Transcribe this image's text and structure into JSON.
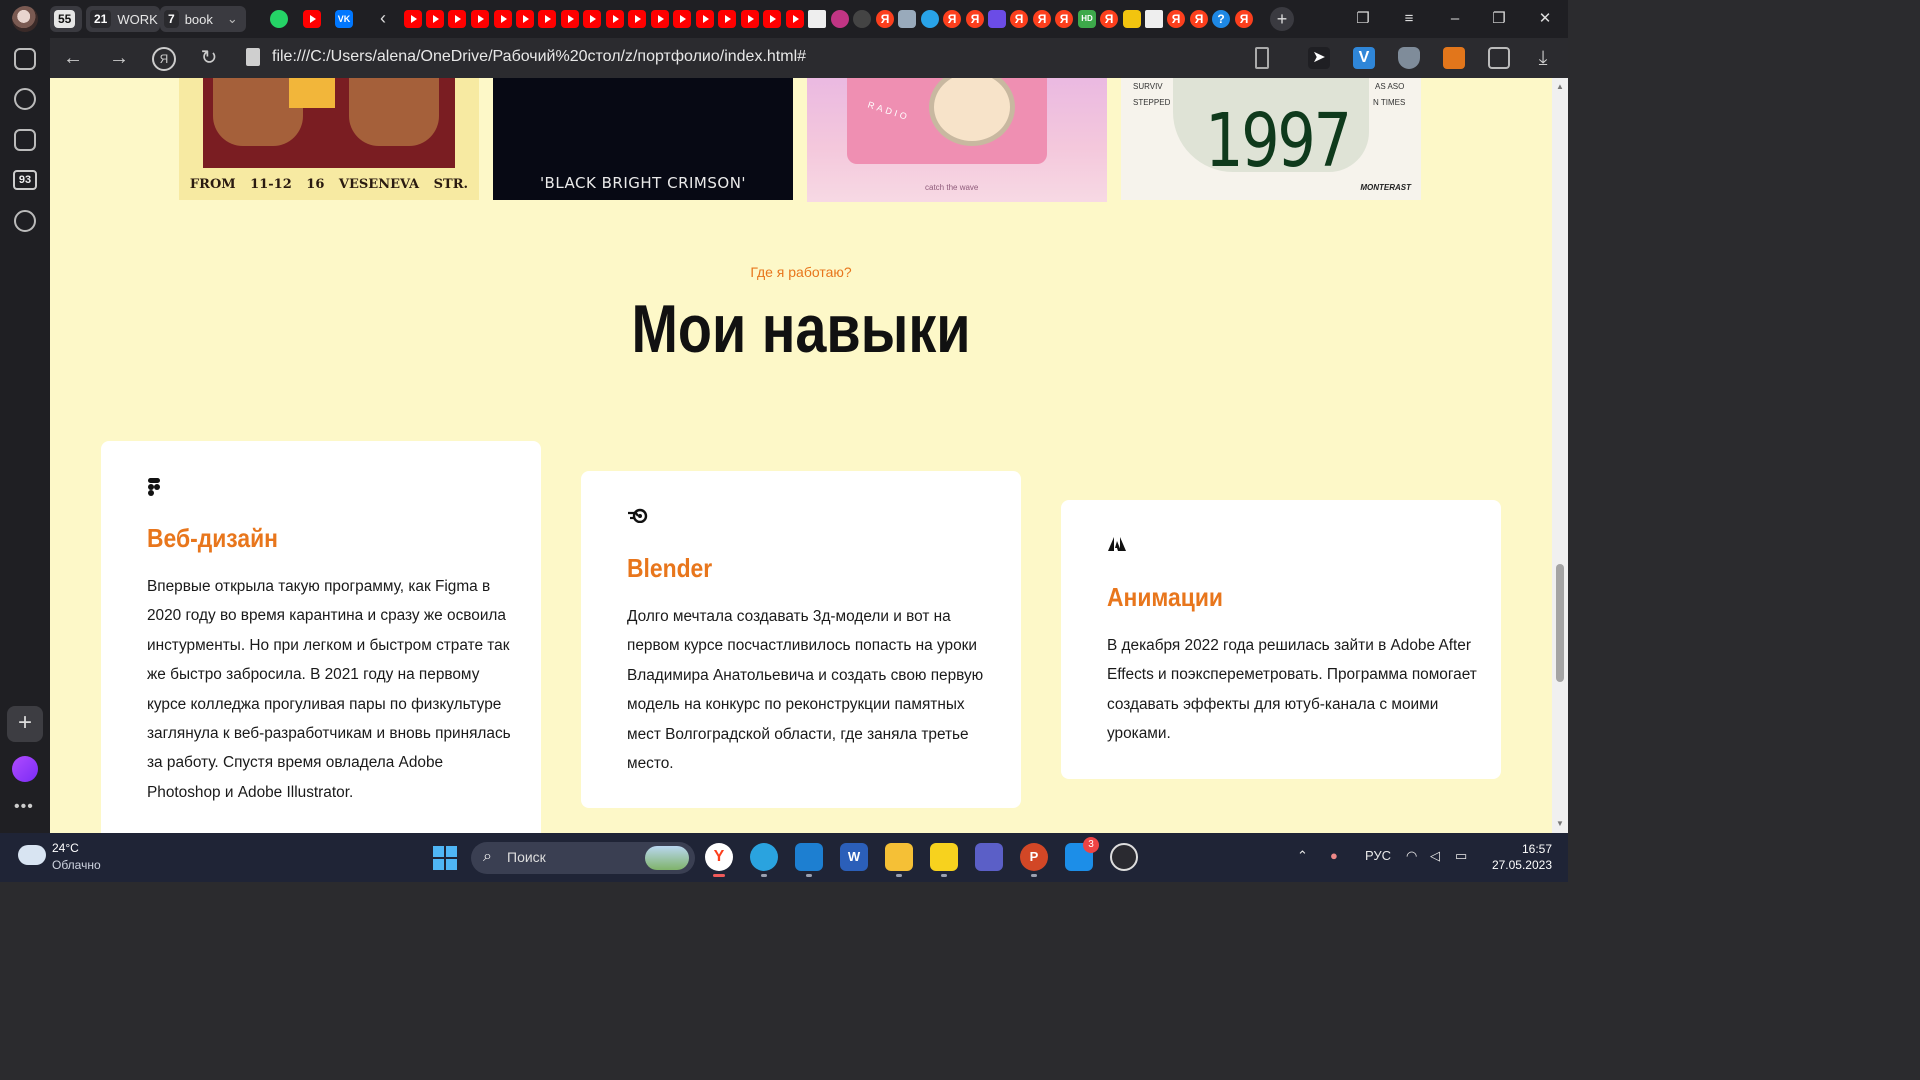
{
  "browser": {
    "tab_groups": [
      {
        "count": "55",
        "label": ""
      },
      {
        "count": "21",
        "label": "WORK"
      },
      {
        "count": "7",
        "label": "book"
      }
    ],
    "url": "file:///C:/Users/alena/OneDrive/Рабочий%20стол/z/портфолио/index.html#",
    "sidebar_counter": "93"
  },
  "page": {
    "portfolio_captions": {
      "poster1": "FROM 11-12   16 VESENEVA STR.",
      "poster2": "'BLACK BRIGHT CRIMSON'",
      "poster3_label": "RADIO",
      "poster3_caption": "catch the wave",
      "poster4_year": "1997",
      "poster4_brand": "MONTERAST",
      "poster4_text1": "SURVIV",
      "poster4_text2": "STEPPED",
      "poster4_text3": "AS ASO",
      "poster4_text4": "N TIMES"
    },
    "section": {
      "subtitle": "Где я работаю?",
      "title": "Мои навыки"
    },
    "skills": [
      {
        "icon": "figma-icon",
        "title": "Веб-дизайн",
        "text": "Впервые открыла такую программу, как Figma в 2020 году во время карантина и сразу же освоила инстурменты. Но при легком и быстром страте так же быстро забросила. В 2021 году на первому курсе колледжа прогуливая пары по физкультуре заглянула к веб-разработчикам и вновь принялась за работу. Спустя время овладела Adobe Photoshop и Adobe Illustrator."
      },
      {
        "icon": "blender-icon",
        "title": "Blender",
        "text": "Долго мечтала создавать 3д-модели и вот на первом курсе посчастливилось попасть на уроки Владимира Анатольевича и создать свою первую модель на конкурс по реконструкции памятных мест Волгоградской области, где заняла третье место."
      },
      {
        "icon": "adobe-icon",
        "title": "Анимации",
        "text": "В декабря 2022 года решилась зайти в Adobe After Effects и поэкспереметровать. Программа помогает создавать эффекты для ютуб-канала с моими уроками."
      }
    ]
  },
  "taskbar": {
    "weather_temp": "24°C",
    "weather_cond": "Облачно",
    "search_label": "Поиск",
    "mail_badge": "3",
    "lang": "РУС",
    "time": "16:57",
    "date": "27.05.2023"
  },
  "colors": {
    "page_bg": "#fdf8c8",
    "accent": "#e8761c",
    "card_bg": "#ffffff"
  }
}
